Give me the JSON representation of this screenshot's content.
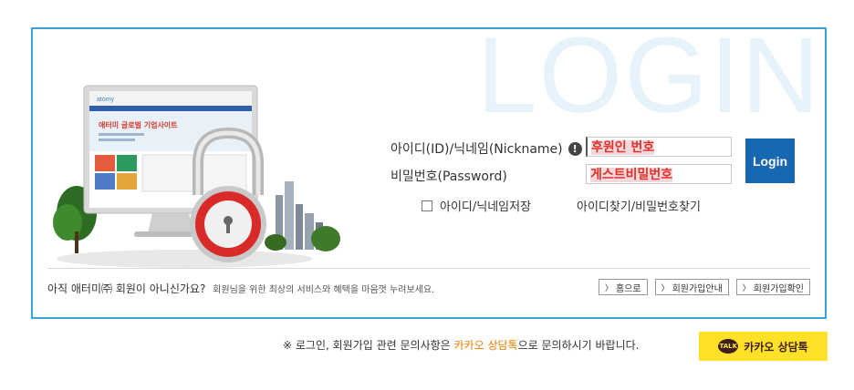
{
  "login_box": {
    "bg_title": "LOGIN",
    "id_label": "아이디(ID)/닉네임(Nickname)",
    "id_help": "!",
    "id_value": "후원인 번호",
    "pw_label": "비밀번호(Password)",
    "pw_value": "게스트비밀번호",
    "login_button": "Login",
    "save_label": "아이디/닉네임저장",
    "find_link": "아이디찾기/비밀번호찾기",
    "footer_main": "아직 애터미㈜ 회원이 아니신가요?",
    "footer_sub": "회원님을 위한 최상의 서비스와 혜택을 마음껏 누려보세요.",
    "buttons": [
      "홈으로",
      "회원가입안내",
      "회원가입확인"
    ]
  },
  "illustration": {
    "site_title": "애터미 글로벌 기업사이트",
    "logo": "atomy"
  },
  "notice": {
    "prefix": "※ 로그인, 회원가입 관련 문의사항은 ",
    "highlight": "카카오 상담톡",
    "suffix": "으로 문의하시기 바랍니다."
  },
  "kakao": {
    "icon_text": "TALK",
    "label": "카카오 상담톡"
  },
  "colors": {
    "accent": "#3aa0d8",
    "login_button": "#1767b1",
    "kakao": "#ffe227",
    "highlight": "#f07d00",
    "field_text": "#e0312a"
  }
}
